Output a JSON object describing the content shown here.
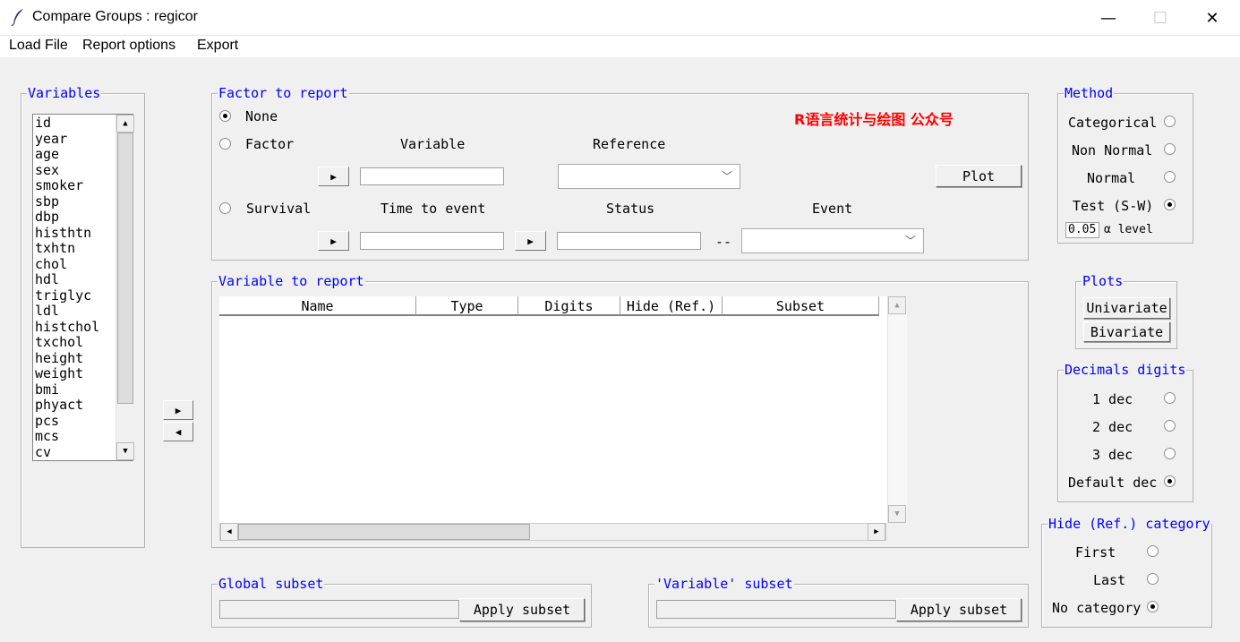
{
  "window": {
    "title": "Compare Groups : regicor",
    "minimize": "—",
    "maximize": "☐",
    "close": "✕"
  },
  "menu": {
    "items": [
      "Load File",
      "Report options",
      "Export"
    ]
  },
  "variables": {
    "title": "Variables",
    "items": [
      "id",
      "year",
      "age",
      "sex",
      "smoker",
      "sbp",
      "dbp",
      "histhtn",
      "txhtn",
      "chol",
      "hdl",
      "triglyc",
      "ldl",
      "histchol",
      "txchol",
      "height",
      "weight",
      "bmi",
      "phyact",
      "pcs",
      "mcs",
      "cv"
    ]
  },
  "factor": {
    "title": "Factor to report",
    "none_label": "None",
    "factor_label": "Factor",
    "variable_label": "Variable",
    "reference_label": "Reference",
    "plot_label": "Plot",
    "survival_label": "Survival",
    "time_label": "Time to event",
    "status_label": "Status",
    "event_label": "Event",
    "dash": "--",
    "selected": "None"
  },
  "watermark": "R语言统计与绘图 公众号",
  "report": {
    "title": "Variable to report",
    "columns": [
      "Name",
      "Type",
      "Digits",
      "Hide (Ref.)",
      "Subset"
    ]
  },
  "method": {
    "title": "Method",
    "options": [
      "Categorical",
      "Non Normal",
      "Normal",
      "Test (S-W)"
    ],
    "selected": "Test (S-W)",
    "alpha_value": "0.05",
    "alpha_label": "α level"
  },
  "plots": {
    "title": "Plots",
    "univariate": "Univariate",
    "bivariate": "Bivariate"
  },
  "decimals": {
    "title": "Decimals digits",
    "options": [
      "1 dec",
      "2 dec",
      "3 dec",
      "Default dec"
    ],
    "selected": "Default dec"
  },
  "hide": {
    "title": "Hide (Ref.) category",
    "options": [
      "First",
      "Last",
      "No category"
    ],
    "selected": "No category"
  },
  "global_subset": {
    "title": "Global subset",
    "button": "Apply subset"
  },
  "variable_subset": {
    "title": "'Variable' subset",
    "button": "Apply subset"
  },
  "icons": {
    "app": "feather-icon",
    "arrow_right": "▶",
    "arrow_left": "◀",
    "scroll_up": "▲",
    "scroll_down": "▼",
    "scroll_left": "◀",
    "scroll_right": "▶",
    "dropdown": "﹀"
  },
  "colors": {
    "group_title": "#0000ff",
    "watermark": "#ff0000",
    "background": "#f0f0f0"
  }
}
